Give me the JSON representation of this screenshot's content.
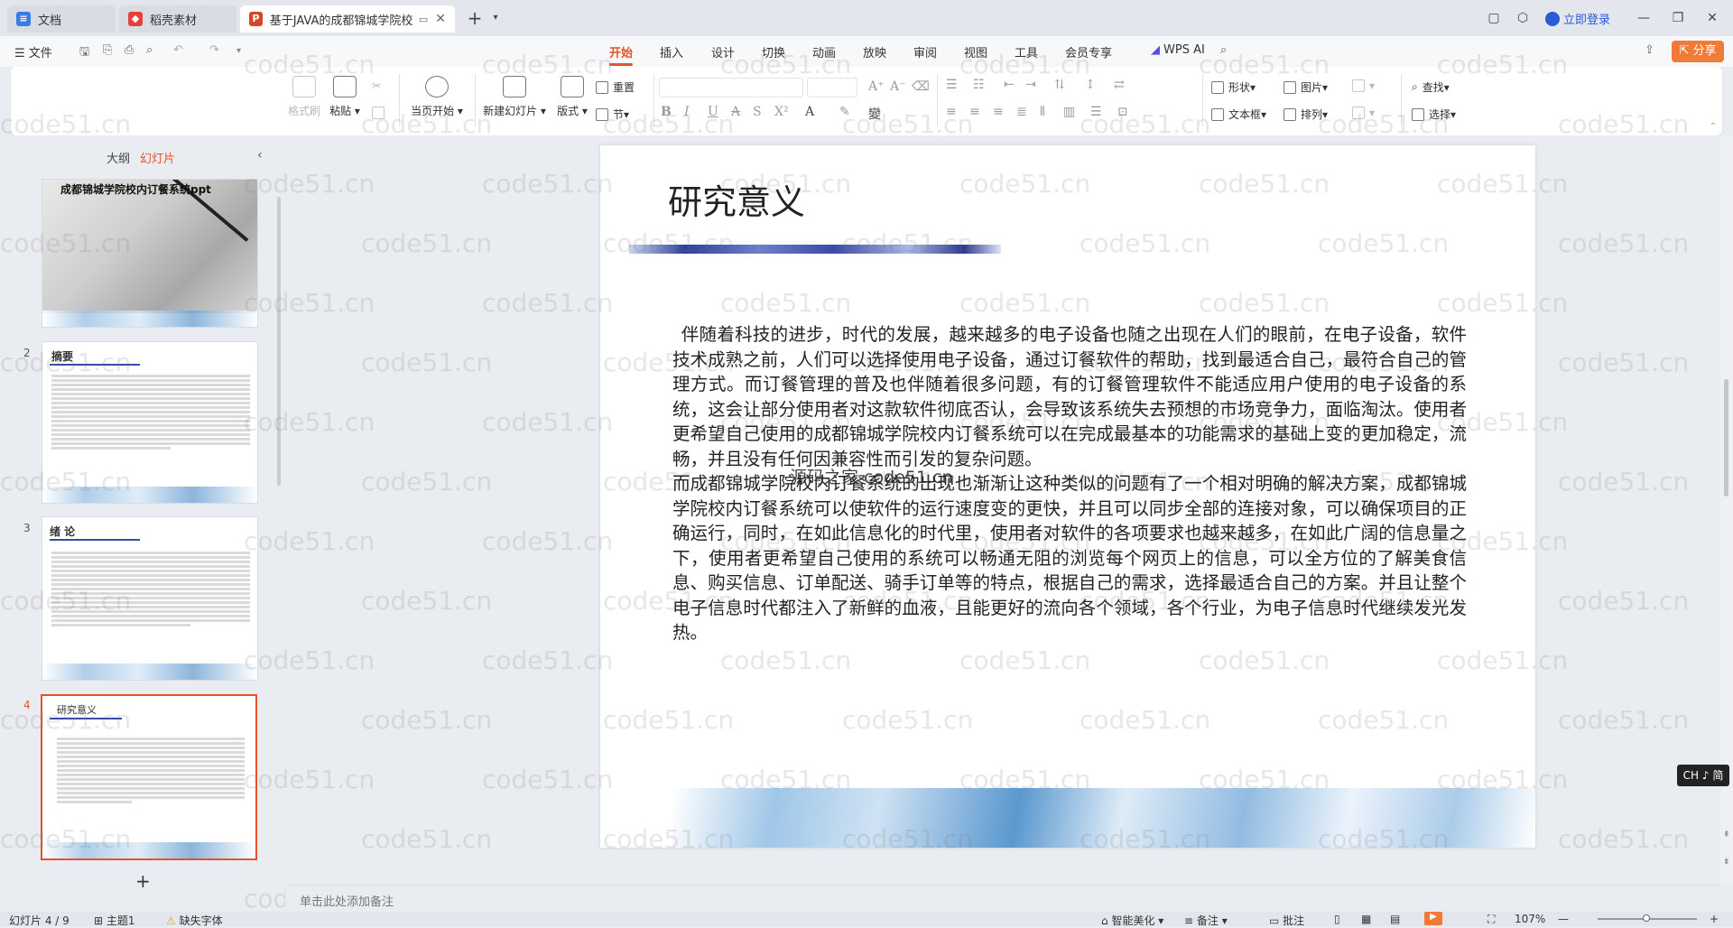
{
  "titlebar": {
    "tabs": [
      {
        "label": "文档",
        "icon": "doc-icon",
        "active": false
      },
      {
        "label": "稻壳素材",
        "icon": "docer-icon",
        "active": false
      },
      {
        "label": "基于JAVA的成都锦城学院校",
        "icon": "ppt-icon",
        "active": true
      }
    ],
    "login": "立即登录"
  },
  "menubar": {
    "file": "文件",
    "tabs": [
      "开始",
      "插入",
      "设计",
      "切换",
      "动画",
      "放映",
      "审阅",
      "视图",
      "工具",
      "会员专享"
    ],
    "active": "开始",
    "wps_ai": "WPS AI",
    "share": "分享"
  },
  "ribbon": {
    "format_painter": "格式刷",
    "paste": "粘贴",
    "play_current": "当页开始",
    "new_slide": "新建幻灯片",
    "layout": "版式",
    "reset": "重置",
    "section": "节",
    "shape": "形状",
    "picture": "图片",
    "textbox": "文本框",
    "arrange": "排列",
    "find": "查找",
    "select": "选择"
  },
  "sidepanel": {
    "outline": "大纲",
    "slides": "幻灯片",
    "thumbs": [
      {
        "num": "",
        "title": "成都锦城学院校内订餐系统ppt"
      },
      {
        "num": "2",
        "title": "摘要"
      },
      {
        "num": "3",
        "title": "绪  论"
      },
      {
        "num": "4",
        "title": "研究意义"
      }
    ]
  },
  "slide": {
    "title": "研究意义",
    "paragraphs": [
      "伴随着科技的进步，时代的发展，越来越多的电子设备也随之出现在人们的眼前，在电子设备，软件技术成熟之前，人们可以选择使用电子设备，通过订餐软件的帮助，找到最适合自己，最符合自己的管理方式。而订餐管理的普及也伴随着很多问题，有的订餐管理软件不能适应用户使用的电子设备的系统，这会让部分使用者对这款软件彻底否认，会导致该系统失去预想的市场竞争力，面临淘汰。使用者更希望自己使用的成都锦城学院校内订餐系统可以在完成最基本的功能需求的基础上变的更加稳定，流畅，并且没有任何因兼容性而引发的复杂问题。",
      "而成都锦城学院校内订餐系统的出现也渐渐让这种类似的问题有了一个相对明确的解决方案，成都锦城学院校内订餐系统可以使软件的运行速度变的更快，并且可以同步全部的连接对象，可以确保项目的正确运行，同时，在如此信息化的时代里，使用者对软件的各项要求也越来越多，在如此广阔的信息量之下，使用者更希望自己使用的系统可以畅通无阻的浏览每个网页上的信息，可以全方位的了解美食信息、购买信息、订单配送、骑手订单等的特点，根据自己的需求，选择最适合自己的方案。并且让整个电子信息时代都注入了新鲜的血液，且能更好的流向各个领域，各个行业，为电子信息时代继续发光发热。"
    ],
    "inline_watermark": "源码之家 code51.cn"
  },
  "watermark": "code51.cn",
  "notes_placeholder": "单击此处添加备注",
  "ime_badge": "CH ♪ 简",
  "statusbar": {
    "slide_counter": "幻灯片 4 / 9",
    "theme": "主题1",
    "missing_font": "缺失字体",
    "beautify": "智能美化",
    "notes": "备注",
    "comments": "批注",
    "zoom": "107%"
  },
  "colors": {
    "accent": "#e5532b",
    "share_bg": "#f07a36"
  }
}
